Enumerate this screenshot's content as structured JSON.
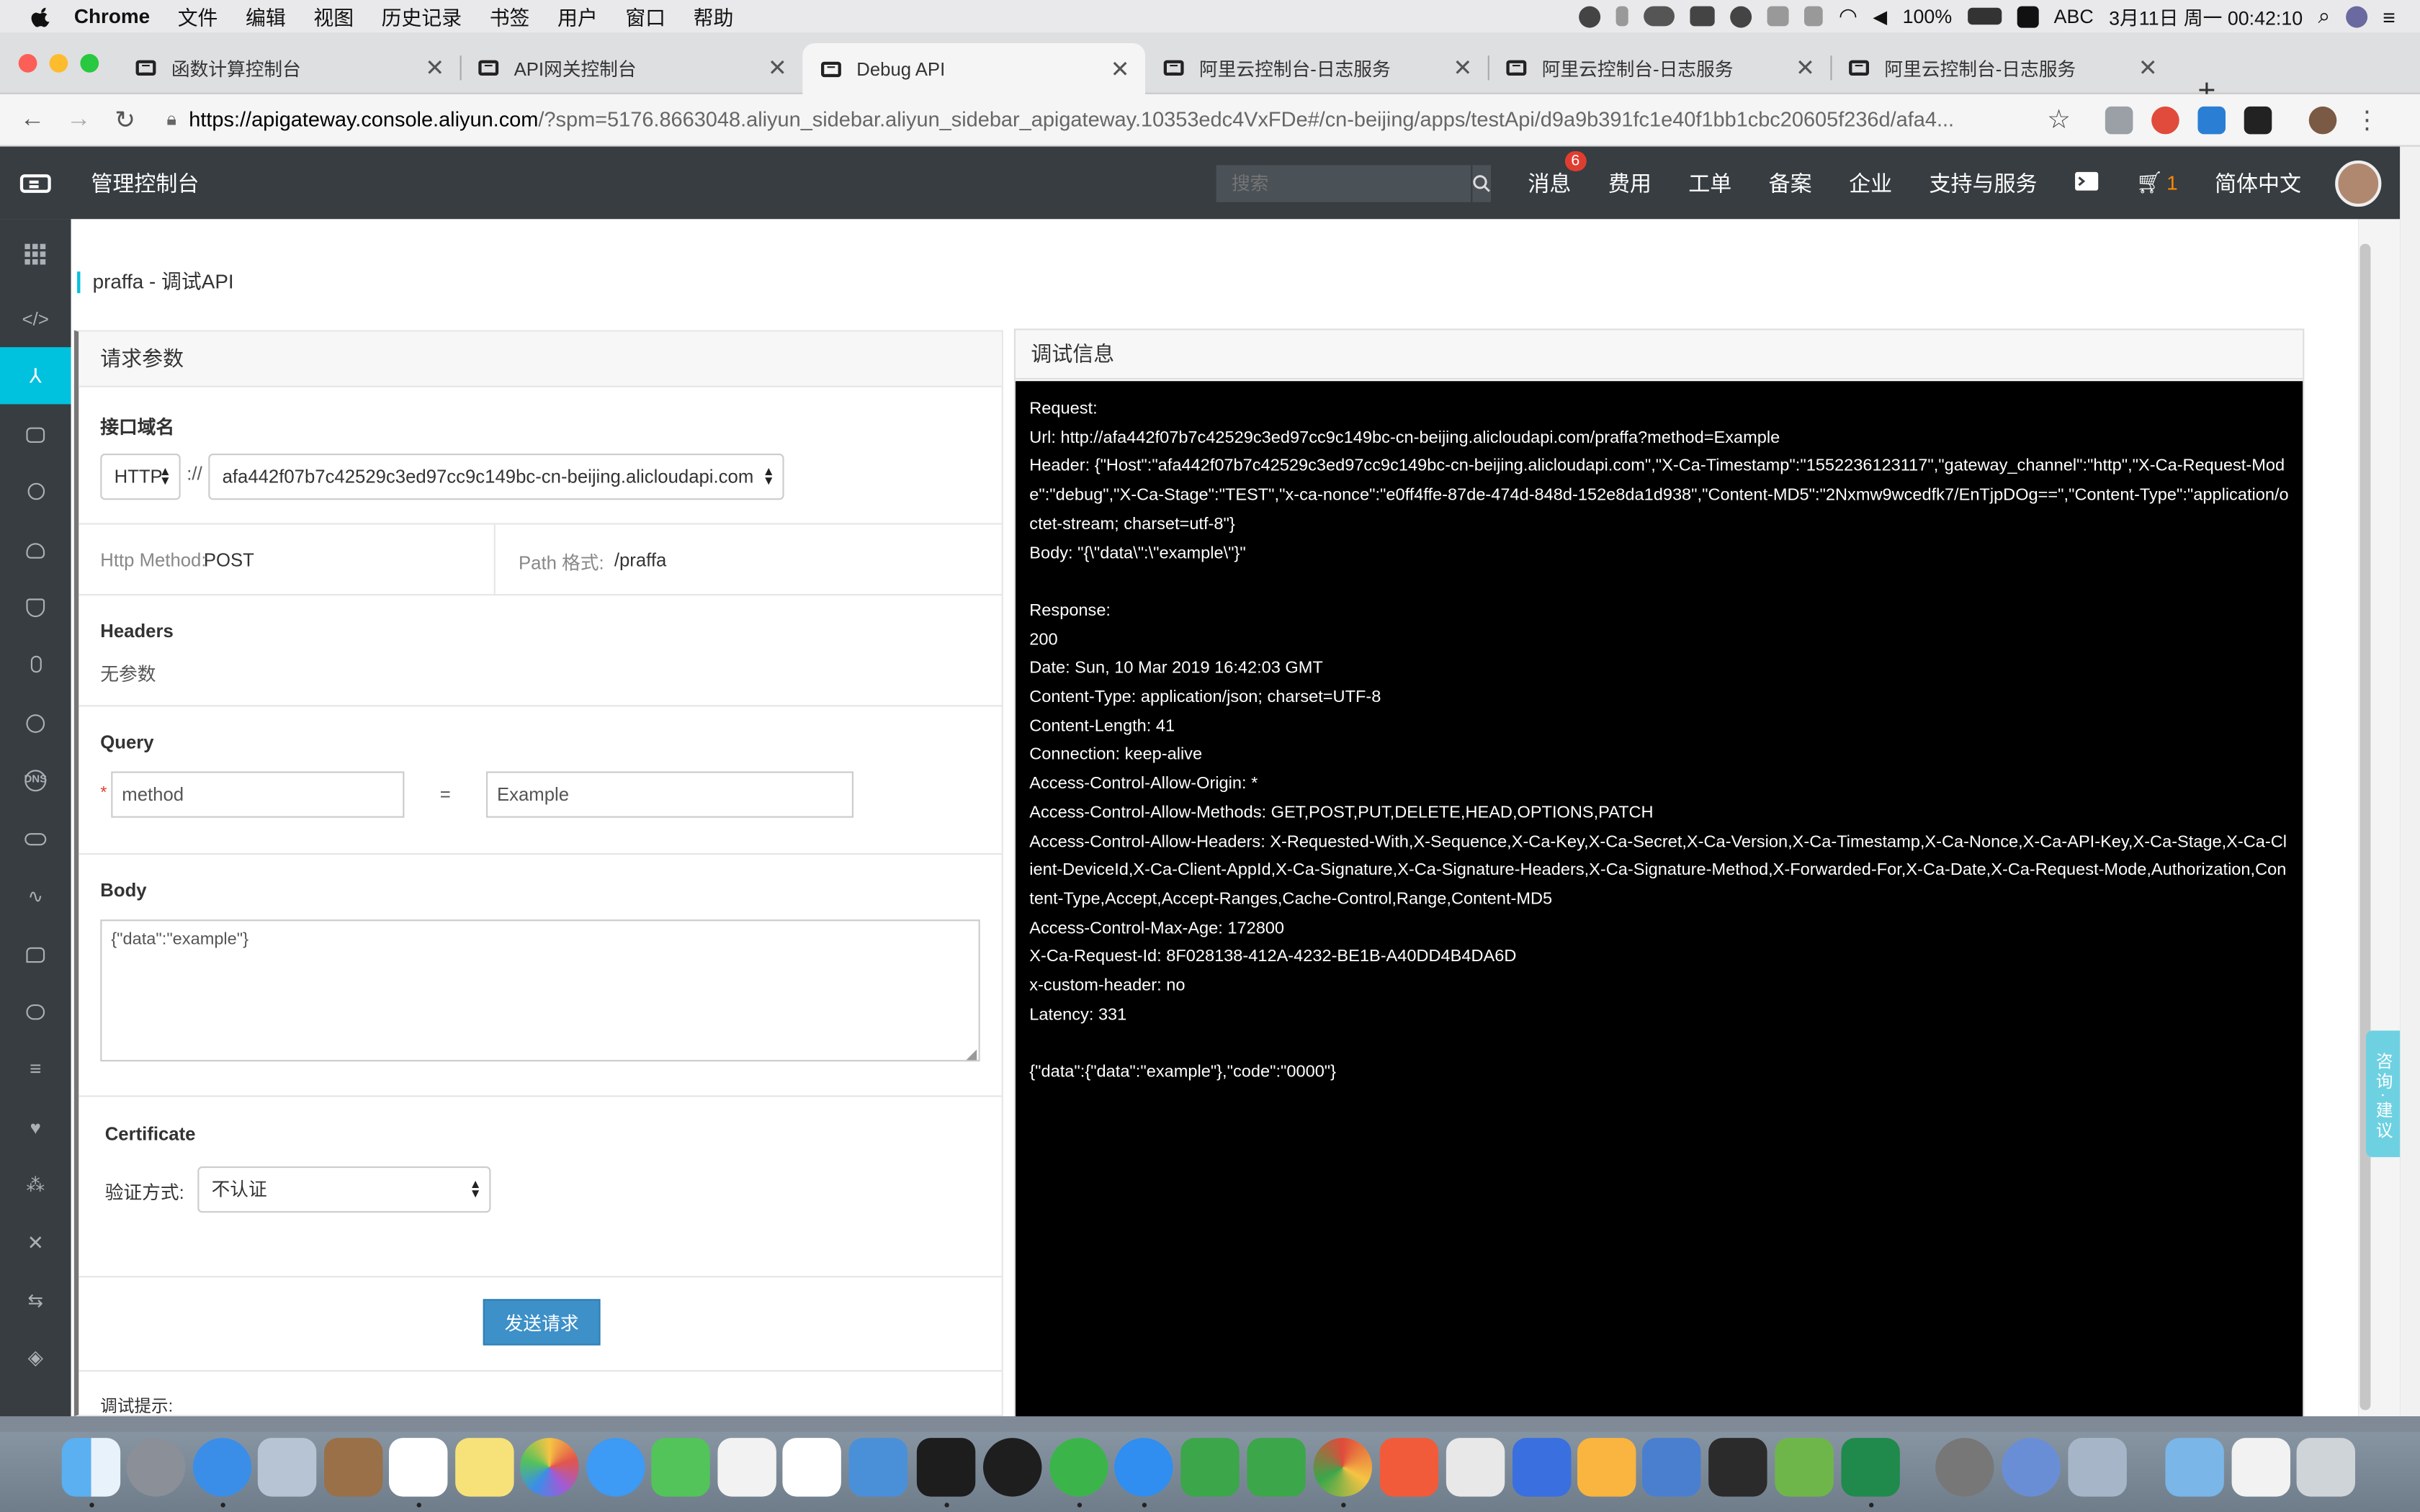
{
  "menubar": {
    "items": [
      "Chrome",
      "文件",
      "编辑",
      "视图",
      "历史记录",
      "书签",
      "用户",
      "窗口",
      "帮助"
    ],
    "battery": "100%",
    "input_method": "ABC",
    "datetime": "3月11日 周一 00:42:10"
  },
  "tabs": [
    {
      "title": "函数计算控制台"
    },
    {
      "title": "API网关控制台"
    },
    {
      "title": "Debug API"
    },
    {
      "title": "阿里云控制台-日志服务"
    },
    {
      "title": "阿里云控制台-日志服务"
    },
    {
      "title": "阿里云控制台-日志服务"
    }
  ],
  "address_bar": {
    "url_host": "https://apigateway.console.aliyun.com",
    "url_rest": "/?spm=5176.8663048.aliyun_sidebar.aliyun_sidebar_apigateway.10353edc4VxFDe#/cn-beijing/apps/testApi/d9a9b391fc1e40f1bb1cbc20605f236d/afa4..."
  },
  "topbar": {
    "title": "管理控制台",
    "search_placeholder": "搜索",
    "messages_label": "消息",
    "messages_count": "6",
    "fees": "费用",
    "tickets": "工单",
    "beian": "备案",
    "enterprise": "企业",
    "support": "支持与服务",
    "cart_count": "1",
    "language": "简体中文"
  },
  "page": {
    "title": "praffa - 调试API"
  },
  "request": {
    "panel_title": "请求参数",
    "domain_label": "接口域名",
    "protocol": "HTTP",
    "separator": "://",
    "domain": "afa442f07b7c42529c3ed97cc9c149bc-cn-beijing.alicloudapi.com",
    "method_label": "Http Method:",
    "method_value": "POST",
    "path_label": "Path 格式:",
    "path_value": "/praffa",
    "headers_label": "Headers",
    "headers_empty": "无参数",
    "query_label": "Query",
    "query_required_mark": "*",
    "query_key": "method",
    "query_eq": "=",
    "query_value": "Example",
    "body_label": "Body",
    "body_value": "{\"data\":\"example\"}",
    "certificate_label": "Certificate",
    "auth_label": "验证方式:",
    "auth_value": "不认证",
    "send_button": "发送请求",
    "tips_label": "调试提示:"
  },
  "debug": {
    "panel_title": "调试信息",
    "output": "Request:\nUrl: http://afa442f07b7c42529c3ed97cc9c149bc-cn-beijing.alicloudapi.com/praffa?method=Example\nHeader: {\"Host\":\"afa442f07b7c42529c3ed97cc9c149bc-cn-beijing.alicloudapi.com\",\"X-Ca-Timestamp\":\"1552236123117\",\"gateway_channel\":\"http\",\"X-Ca-Request-Mode\":\"debug\",\"X-Ca-Stage\":\"TEST\",\"x-ca-nonce\":\"e0ff4ffe-87de-474d-848d-152e8da1d938\",\"Content-MD5\":\"2Nxmw9wcedfk7/EnTjpDOg==\",\"Content-Type\":\"application/octet-stream; charset=utf-8\"}\nBody: \"{\\\"data\\\":\\\"example\\\"}\"\n\nResponse:\n200\nDate: Sun, 10 Mar 2019 16:42:03 GMT\nContent-Type: application/json; charset=UTF-8\nContent-Length: 41\nConnection: keep-alive\nAccess-Control-Allow-Origin: *\nAccess-Control-Allow-Methods: GET,POST,PUT,DELETE,HEAD,OPTIONS,PATCH\nAccess-Control-Allow-Headers: X-Requested-With,X-Sequence,X-Ca-Key,X-Ca-Secret,X-Ca-Version,X-Ca-Timestamp,X-Ca-Nonce,X-Ca-API-Key,X-Ca-Stage,X-Ca-Client-DeviceId,X-Ca-Client-AppId,X-Ca-Signature,X-Ca-Signature-Headers,X-Ca-Signature-Method,X-Forwarded-For,X-Ca-Date,X-Ca-Request-Mode,Authorization,Content-Type,Accept,Accept-Ranges,Cache-Control,Range,Content-MD5\nAccess-Control-Max-Age: 172800\nX-Ca-Request-Id: 8F028138-412A-4232-BE1B-A40DD4B4DA6D\nx-custom-header: no\nLatency: 331\n\n{\"data\":{\"data\":\"example\"},\"code\":\"0000\"}"
  },
  "consult_widget": "咨询·建议",
  "colors": {
    "topbar": "#373d41",
    "accent": "#00c1de",
    "primary_button": "#3d90c8",
    "console_bg": "#000000"
  }
}
